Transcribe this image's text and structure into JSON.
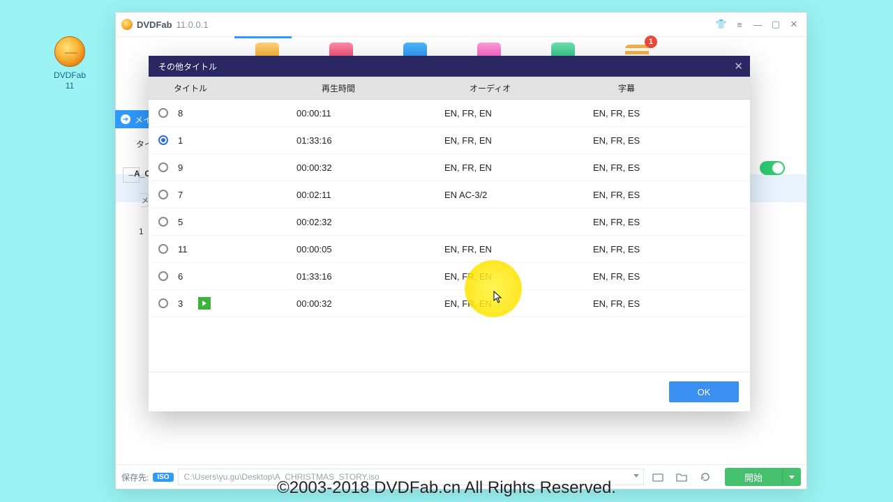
{
  "desktop": {
    "icon_label": "DVDFab 11"
  },
  "app": {
    "name": "DVDFab",
    "version": "11.0.0.1"
  },
  "notif_badge": "1",
  "main_pill": "メイン",
  "bg_labels": {
    "ti": "タイ",
    "ac": "A_C",
    "pill": "メ",
    "one": "1"
  },
  "statusbar": {
    "save_label": "保存先:",
    "iso_tag": "ISO",
    "path": "C:\\Users\\yu.gu\\Desktop\\A_CHRISTMAS_STORY.iso",
    "start": "開始"
  },
  "modal": {
    "title": "その他タイトル",
    "headers": {
      "title": "タイトル",
      "duration": "再生時間",
      "audio": "オーディオ",
      "subtitle": "字幕"
    },
    "ok": "OK",
    "rows": [
      {
        "n": "8",
        "dur": "00:00:11",
        "aud": "EN, FR, EN",
        "sub": "EN, FR, ES",
        "selected": false,
        "playing": false
      },
      {
        "n": "1",
        "dur": "01:33:16",
        "aud": "EN, FR, EN",
        "sub": "EN, FR, ES",
        "selected": true,
        "playing": false
      },
      {
        "n": "9",
        "dur": "00:00:32",
        "aud": "EN, FR, EN",
        "sub": "EN, FR, ES",
        "selected": false,
        "playing": false
      },
      {
        "n": "7",
        "dur": "00:02:11",
        "aud": "EN AC-3/2",
        "sub": "EN, FR, ES",
        "selected": false,
        "playing": false
      },
      {
        "n": "5",
        "dur": "00:02:32",
        "aud": "",
        "sub": "EN, FR, ES",
        "selected": false,
        "playing": false
      },
      {
        "n": "11",
        "dur": "00:00:05",
        "aud": "EN, FR, EN",
        "sub": "EN, FR, ES",
        "selected": false,
        "playing": false
      },
      {
        "n": "6",
        "dur": "01:33:16",
        "aud": "EN, FR, EN",
        "sub": "EN, FR, ES",
        "selected": false,
        "playing": false
      },
      {
        "n": "3",
        "dur": "00:00:32",
        "aud": "EN, FR, EN",
        "sub": "EN, FR, ES",
        "selected": false,
        "playing": true
      }
    ]
  },
  "copyright": "©2003-2018 DVDFab.cn All Rights Reserved."
}
